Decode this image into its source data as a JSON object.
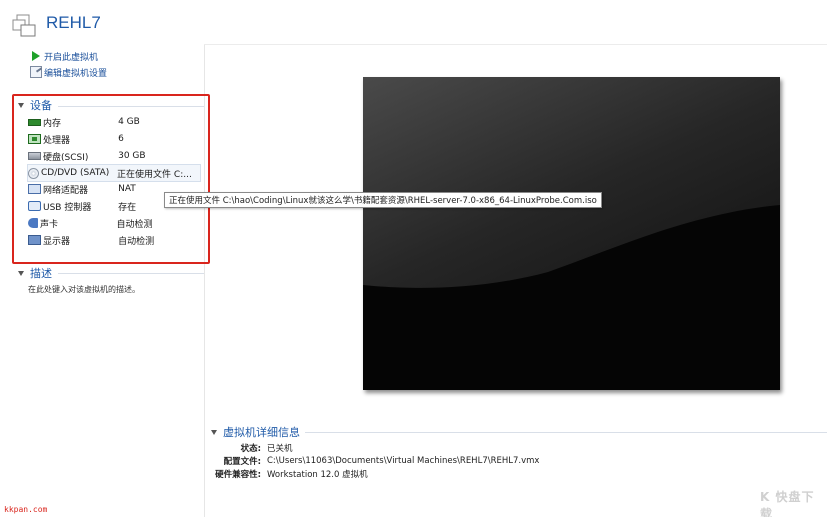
{
  "vm": {
    "title": "REHL7"
  },
  "actions": [
    {
      "label": "开启此虚拟机",
      "icon": "play-icon"
    },
    {
      "label": "编辑虚拟机设置",
      "icon": "edit-settings-icon"
    }
  ],
  "devices_section": {
    "title": "设备",
    "items": [
      {
        "name": "内存",
        "value": "4 GB",
        "icon": "memory-icon"
      },
      {
        "name": "处理器",
        "value": "6",
        "icon": "processor-icon"
      },
      {
        "name": "硬盘(SCSI)",
        "value": "30 GB",
        "icon": "hard-disk-icon"
      },
      {
        "name": "CD/DVD (SATA)",
        "value": "正在使用文件 C:...",
        "icon": "cd-dvd-icon"
      },
      {
        "name": "网络适配器",
        "value": "NAT",
        "icon": "network-adapter-icon"
      },
      {
        "name": "USB 控制器",
        "value": "存在",
        "icon": "usb-icon"
      },
      {
        "name": "声卡",
        "value": "自动检测",
        "icon": "sound-card-icon"
      },
      {
        "name": "显示器",
        "value": "自动检测",
        "icon": "display-icon"
      }
    ]
  },
  "tooltip": {
    "text": "正在使用文件 C:\\hao\\Coding\\Linux就该这么学\\书籍配套资源\\RHEL-server-7.0-x86_64-LinuxProbe.Com.iso"
  },
  "description_section": {
    "title": "描述",
    "placeholder": "在此处键入对该虚拟机的描述。"
  },
  "details_section": {
    "title": "虚拟机详细信息",
    "rows": [
      {
        "key": "状态:",
        "value": "已关机"
      },
      {
        "key": "配置文件:",
        "value": "C:\\Users\\11063\\Documents\\Virtual Machines\\REHL7\\REHL7.vmx"
      },
      {
        "key": "硬件兼容性:",
        "value": "Workstation 12.0 虚拟机"
      }
    ]
  },
  "watermarks": {
    "left": "kkpan.com",
    "right": "K 快盘下载"
  },
  "colors": {
    "accent": "#1f5aa8",
    "highlight": "#d9251d",
    "play": "#1fa12a"
  }
}
